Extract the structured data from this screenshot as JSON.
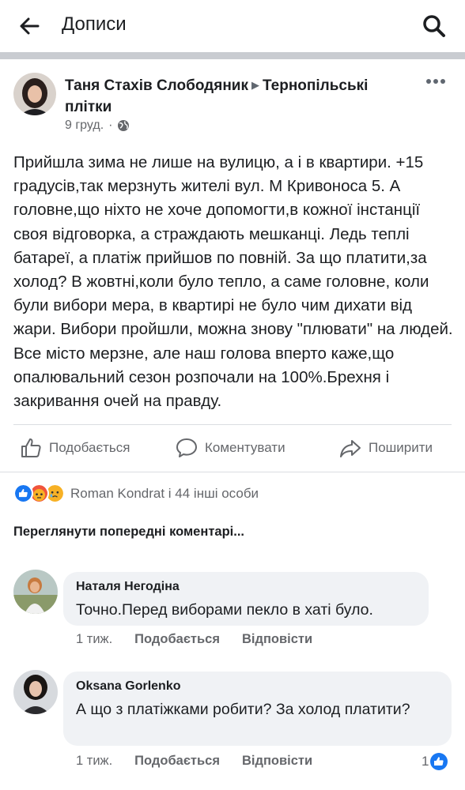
{
  "header": {
    "title": "Дописи",
    "back_icon": "arrow-left-icon",
    "search_icon": "search-icon"
  },
  "post": {
    "author": "Таня Стахів Слободяник",
    "separator": "▶",
    "group": "Тернопільські плітки",
    "date": "9 груд.",
    "dot": "·",
    "privacy_icon": "globe-icon",
    "text": "Прийшла зима не лише на вулицю, а і в квартири. +15 градусів,так мерзнуть жителі вул. М Кривоноса 5. А головне,що ніхто не хоче допомогти,в кожної інстанції своя відговорка, а страждають мешканці. Ледь теплі батареї, а платіж прийшов по повній. За що платити,за холод? В жовтні,коли було тепло, а саме головне, коли були вибори мера, в квартирі не було чим дихати від жари. Вибори пройшли, можна знову \"плювати\" на людей. Все місто мерзне, але наш голова вперто каже,що опалювальний сезон розпочали на 100%.Брехня і закривання очей на правду."
  },
  "actions": {
    "like": "Подобається",
    "comment": "Коментувати",
    "share": "Поширити"
  },
  "reactions": {
    "summary": "Roman Kondrat і 44 інші особи",
    "icons": [
      "like-reaction-icon",
      "angry-reaction-icon",
      "sad-reaction-icon"
    ],
    "colors": {
      "like": "#1877f2",
      "angry": "#f0543c",
      "sad": "#f7b125"
    }
  },
  "comments_section": {
    "view_previous": "Переглянути попередні коментарі..."
  },
  "comments": [
    {
      "name": "Наталя Негодіна",
      "text": "Точно.Перед виборами пекло в хаті було.",
      "time": "1 тиж.",
      "like": "Подобається",
      "reply": "Відповісти"
    },
    {
      "name": "Oksana Gorlenko",
      "text": "А що з платіжками робити? За холод платити?",
      "time": "1 тиж.",
      "like": "Подобається",
      "reply": "Відповісти",
      "reaction_count": "1"
    }
  ]
}
